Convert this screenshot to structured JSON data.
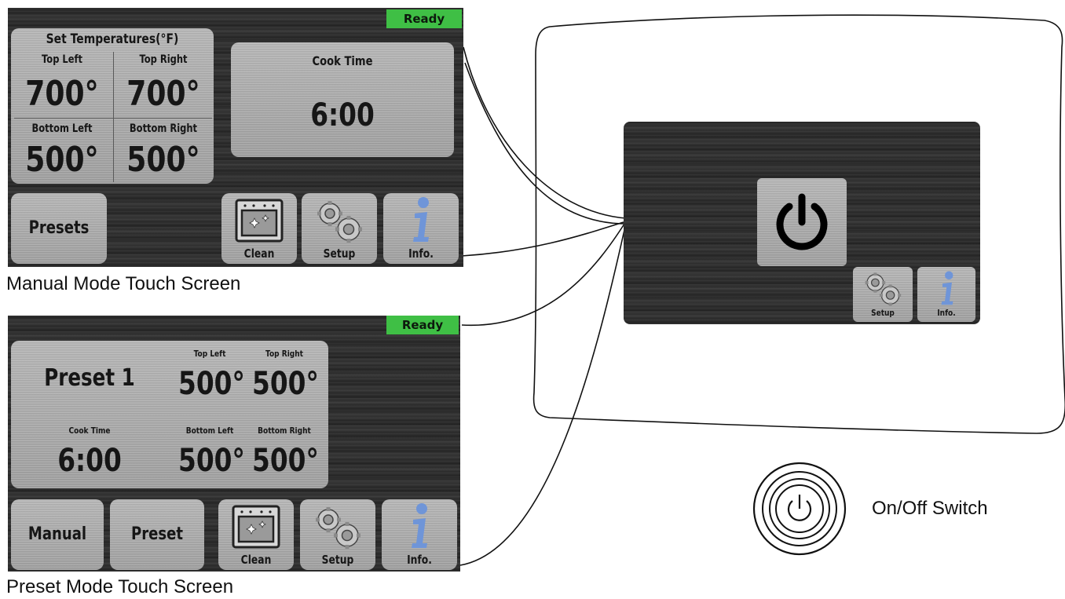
{
  "manual_screen": {
    "status": "Ready",
    "set_temps_title": "Set Temperatures(°F)",
    "top_left_label": "Top Left",
    "top_right_label": "Top Right",
    "bottom_left_label": "Bottom Left",
    "bottom_right_label": "Bottom Right",
    "top_left_value": "700°",
    "top_right_value": "700°",
    "bottom_left_value": "500°",
    "bottom_right_value": "500°",
    "cook_time_label": "Cook Time",
    "cook_time_value": "6:00",
    "presets_button": "Presets",
    "clean_button": "Clean",
    "setup_button": "Setup",
    "info_button": "Info.",
    "caption": "Manual Mode Touch Screen"
  },
  "preset_screen": {
    "status": "Ready",
    "preset_name": "Preset 1",
    "top_left_label": "Top Left",
    "top_right_label": "Top Right",
    "bottom_left_label": "Bottom Left",
    "bottom_right_label": "Bottom Right",
    "top_left_value": "500°",
    "top_right_value": "500°",
    "bottom_left_value": "500°",
    "bottom_right_value": "500°",
    "cook_time_label": "Cook Time",
    "cook_time_value": "6:00",
    "manual_button": "Manual",
    "preset_button": "Preset",
    "clean_button": "Clean",
    "setup_button": "Setup",
    "info_button": "Info.",
    "caption": "Preset Mode Touch Screen"
  },
  "standby_screen": {
    "setup_button": "Setup",
    "info_button": "Info."
  },
  "switch_label": "On/Off Switch",
  "colors": {
    "ready_green": "#3fbf45",
    "info_blue": "#6f95d8",
    "screen_dark": "#2c2c2c",
    "panel_silver": "#a9a9a9"
  }
}
